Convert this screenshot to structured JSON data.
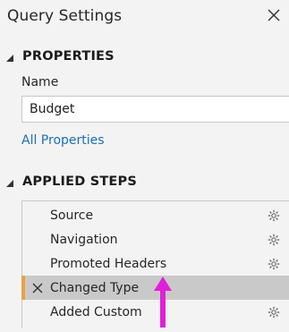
{
  "panel": {
    "title": "Query Settings",
    "close_icon": "close-icon"
  },
  "properties": {
    "heading": "PROPERTIES",
    "name_label": "Name",
    "name_value": "Budget",
    "all_properties_link": "All Properties"
  },
  "applied_steps": {
    "heading": "APPLIED STEPS",
    "items": [
      {
        "label": "Source",
        "has_settings": true,
        "selected": false
      },
      {
        "label": "Navigation",
        "has_settings": true,
        "selected": false
      },
      {
        "label": "Promoted Headers",
        "has_settings": true,
        "selected": false
      },
      {
        "label": "Changed Type",
        "has_settings": false,
        "selected": true
      },
      {
        "label": "Added Custom",
        "has_settings": true,
        "selected": false
      }
    ]
  },
  "colors": {
    "accent": "#e8a33d",
    "link": "#1b6fb3",
    "annotation_arrow": "#e020d8",
    "selected_row": "#c9c9c9"
  }
}
